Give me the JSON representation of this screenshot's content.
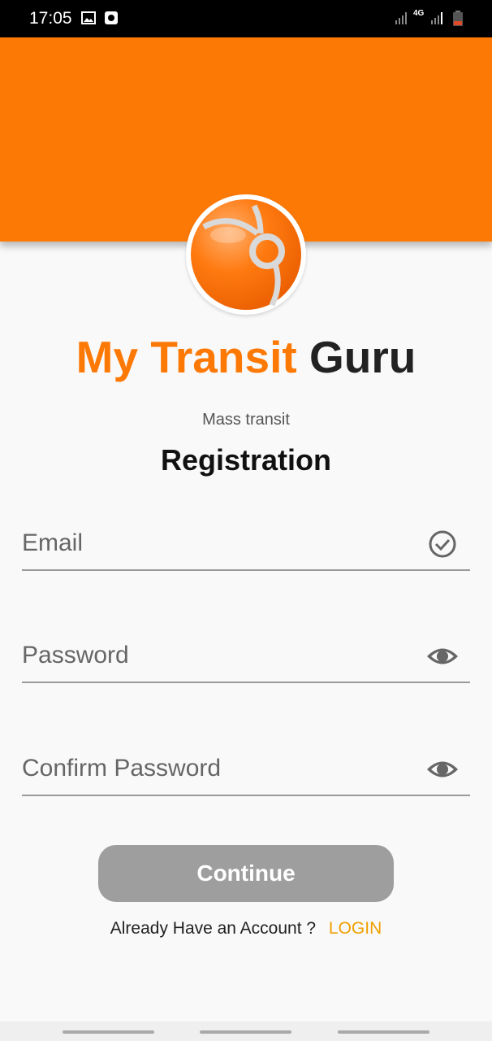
{
  "status_bar": {
    "time": "17:05",
    "icons": [
      "image-icon",
      "media-icon",
      "signal-icon",
      "network-4g-icon",
      "signal-icon",
      "battery-icon"
    ],
    "network_label": "4G"
  },
  "colors": {
    "brand_orange": "#fd7906",
    "dark_text": "#222222",
    "button_disabled": "#9e9e9e",
    "link": "#f0a000"
  },
  "app": {
    "title_part1": "My Transit",
    "title_part2": "Guru",
    "subtitle": "Mass transit",
    "heading": "Registration"
  },
  "form": {
    "email": {
      "placeholder": "Email",
      "value": "",
      "icon": "check-circle-icon"
    },
    "password": {
      "placeholder": "Password",
      "value": "",
      "icon": "eye-icon"
    },
    "confirm_password": {
      "placeholder": "Confirm Password",
      "value": "",
      "icon": "eye-icon"
    }
  },
  "actions": {
    "continue_label": "Continue",
    "already_text": "Already Have an Account ?",
    "login_label": "LOGIN"
  }
}
